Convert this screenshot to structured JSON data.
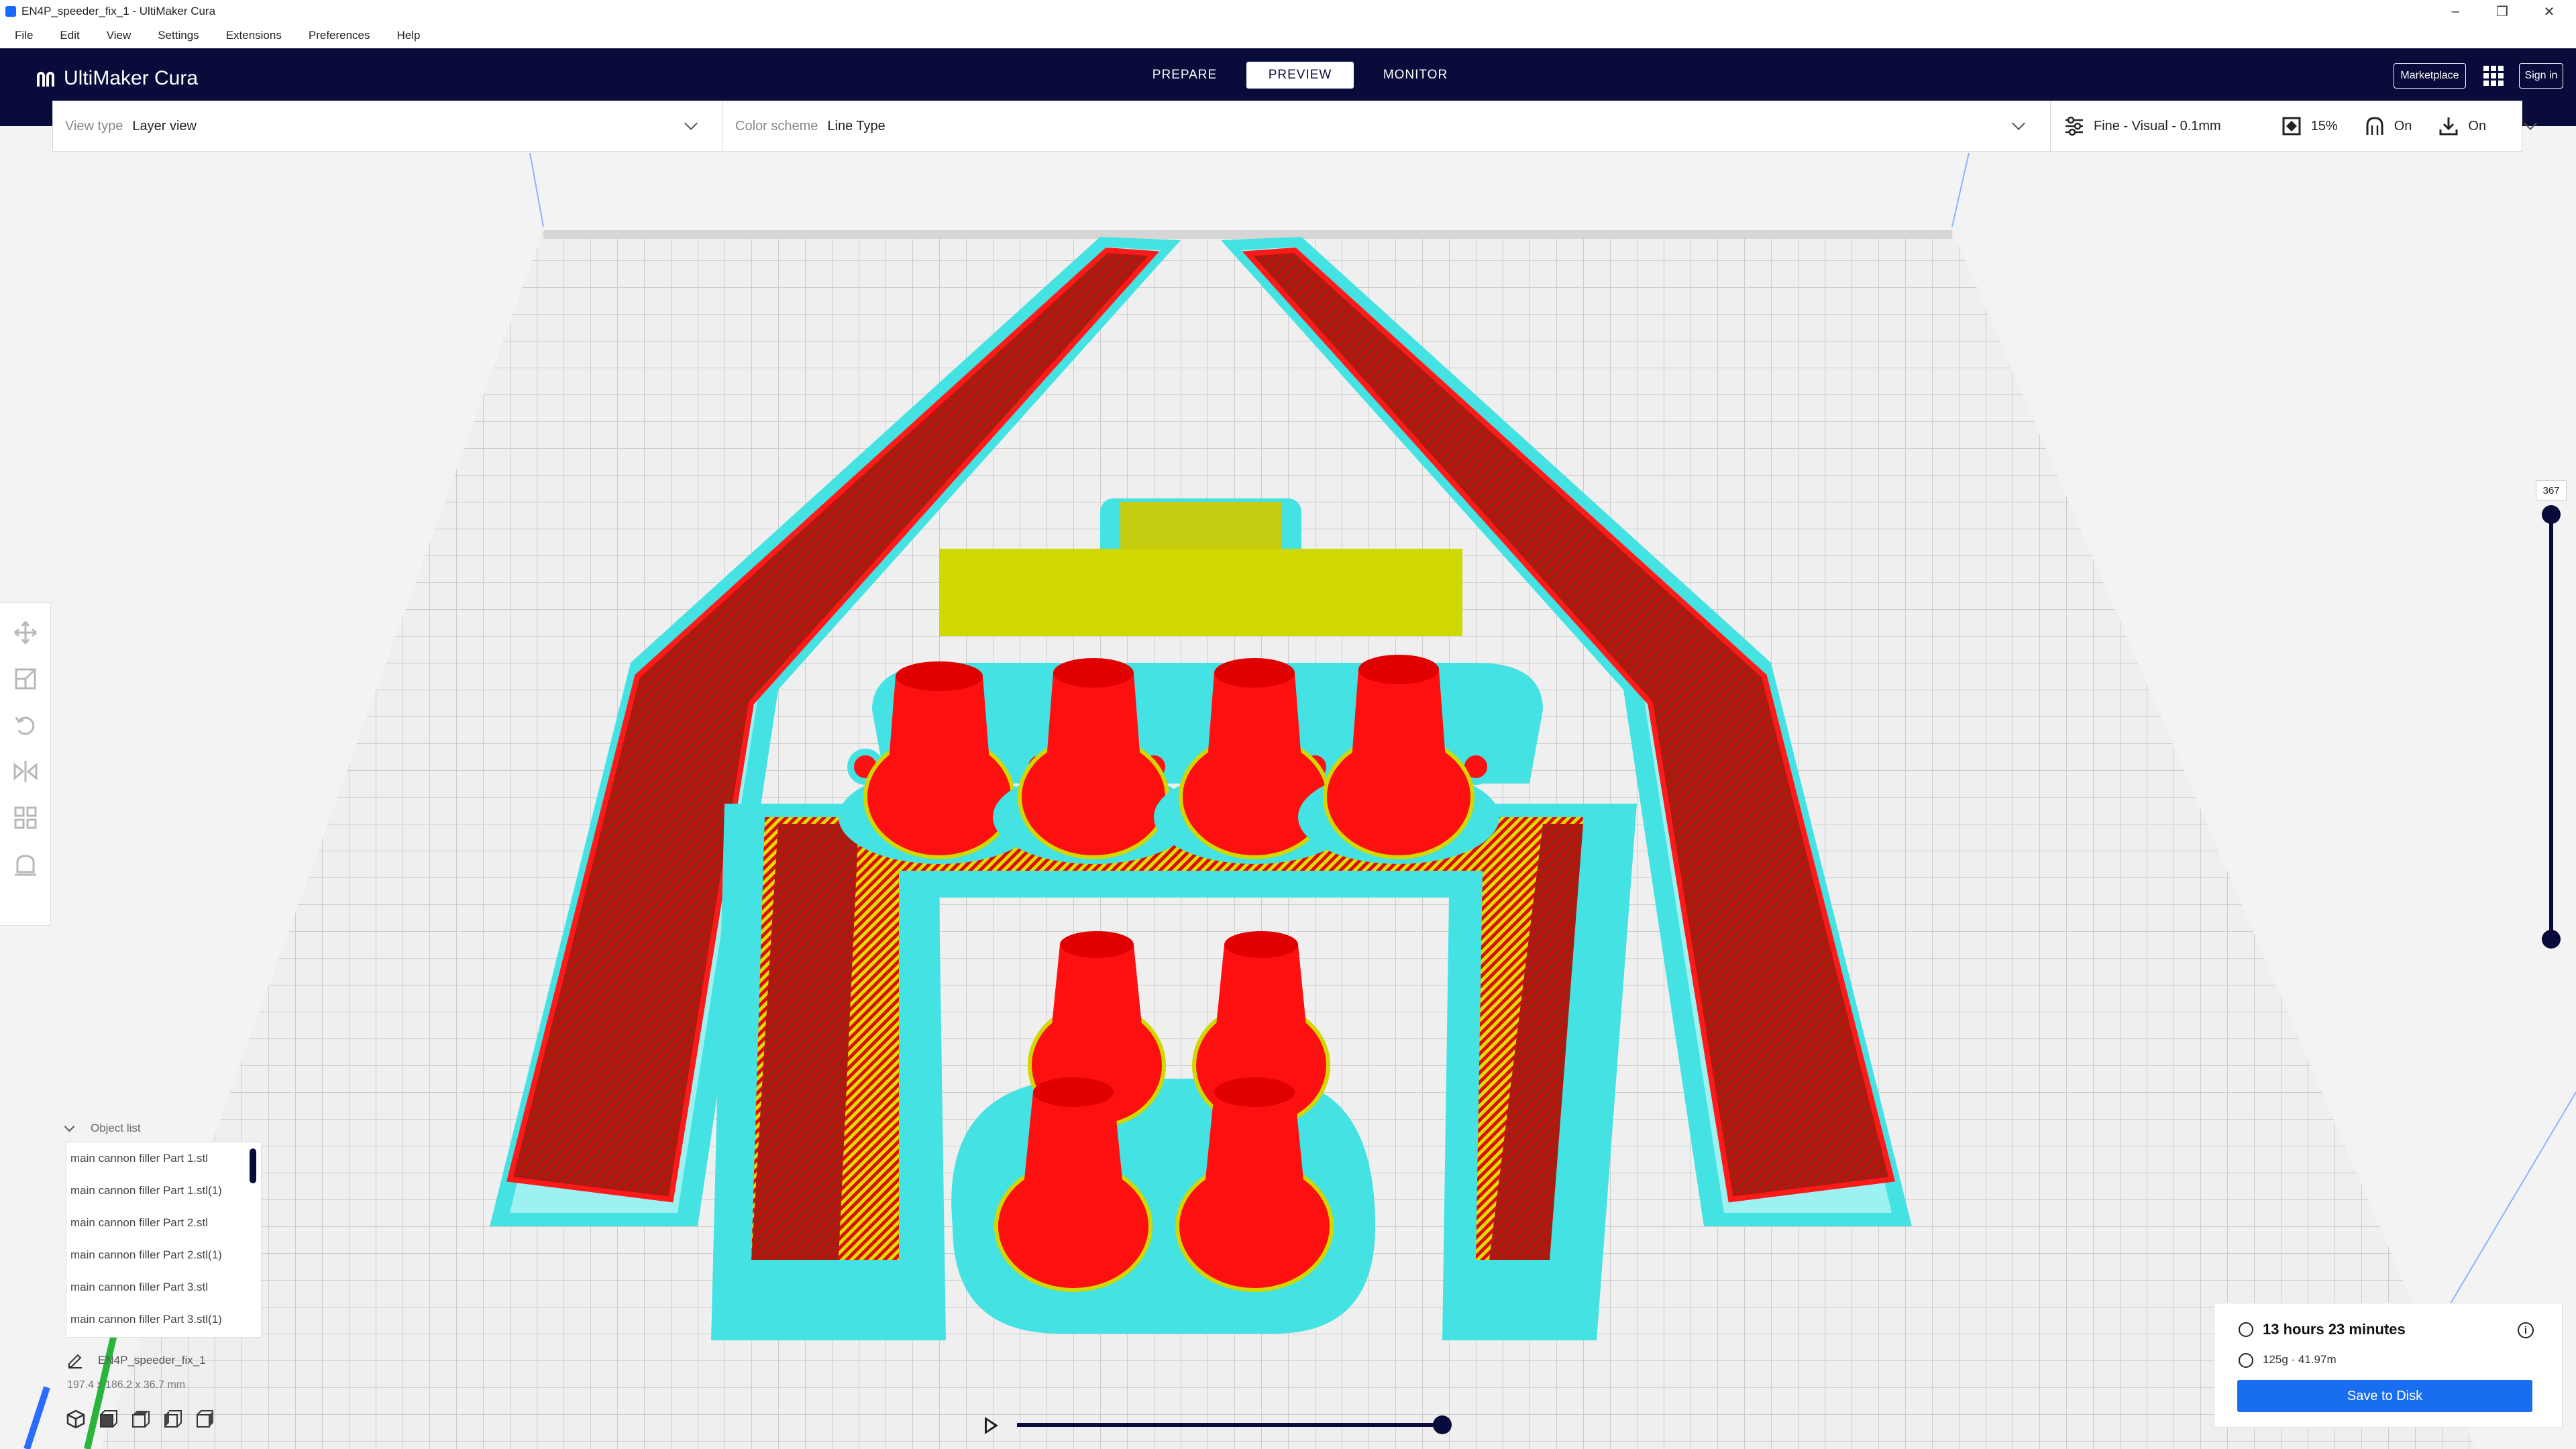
{
  "window": {
    "title": "EN4P_speeder_fix_1 - UltiMaker Cura",
    "controls": [
      "–",
      "❐",
      "✕"
    ]
  },
  "menu": [
    "File",
    "Edit",
    "View",
    "Settings",
    "Extensions",
    "Preferences",
    "Help"
  ],
  "header": {
    "brand": "UltiMaker Cura",
    "stages": [
      "PREPARE",
      "PREVIEW",
      "MONITOR"
    ],
    "active_stage": "PREVIEW",
    "marketplace": "Marketplace",
    "sign_in": "Sign in"
  },
  "view_toolbar": {
    "view_type_label": "View type",
    "view_type_value": "Layer view",
    "color_scheme_label": "Color scheme",
    "color_scheme_value": "Line Type",
    "profile": "Fine - Visual - 0.1mm",
    "infill": "15%",
    "support": "On",
    "adhesion": "On"
  },
  "layer_slider": {
    "current_layer": "367"
  },
  "object_list": {
    "heading": "Object list",
    "items": [
      "main cannon filler Part 1.stl",
      "main cannon filler Part 1.stl(1)",
      "main cannon filler Part 2.stl",
      "main cannon filler Part 2.stl(1)",
      "main cannon filler Part 3.stl",
      "main cannon filler Part 3.stl(1)"
    ],
    "job_name": "EN4P_speeder_fix_1",
    "dimensions": "197.4 x 186.2 x 36.7 mm"
  },
  "print_info": {
    "time": "13 hours 23 minutes",
    "material": "125g · 41.97m",
    "save_button": "Save to Disk"
  },
  "colors": {
    "header_bg": "#090b3a",
    "accent_blue": "#196ef0",
    "wall_red": "#f01010",
    "skirt_cyan": "#3ee0e0",
    "infill_yellow": "#d8e000"
  }
}
